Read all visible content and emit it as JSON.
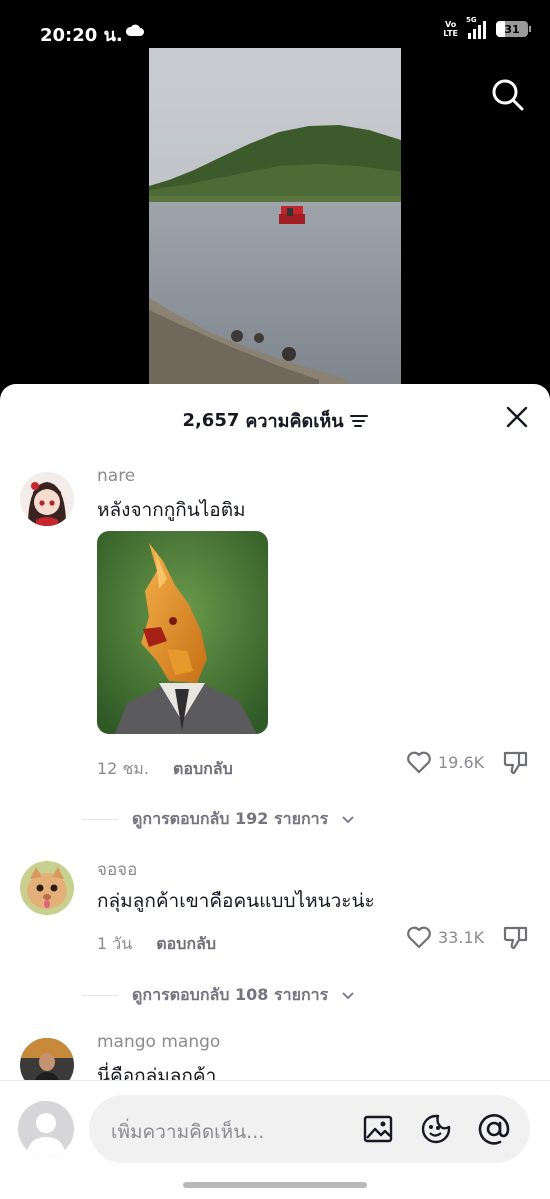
{
  "status": {
    "time": "20:20 น.",
    "volte": [
      "Vo",
      "LTE"
    ],
    "network": "5G",
    "battery": "31"
  },
  "comments_sheet": {
    "count": "2,657",
    "title_label": "ความคิดเห็น",
    "comments": [
      {
        "user": "nare",
        "text": "หลังจากกูกินไอติม",
        "time": "12 ชม.",
        "reply_label": "ตอบกลับ",
        "likes": "19.6K",
        "view_replies": "ดูการตอบกลับ 192 รายการ"
      },
      {
        "user": "จอจอ",
        "text": "กลุ่มลูกค้าเขาคือคนแบบไหนวะน่ะ",
        "time": "1 วัน",
        "reply_label": "ตอบกลับ",
        "likes": "33.1K",
        "view_replies": "ดูการตอบกลับ 108 รายการ"
      },
      {
        "user": "mango mango",
        "text": "นี่คือกลุ่มลูกค้า"
      }
    ]
  },
  "input": {
    "placeholder": "เพิ่มความคิดเห็น..."
  },
  "icons": [
    "cloud-icon",
    "search-icon",
    "sort-icon",
    "close-icon",
    "heart-icon",
    "dislike-icon",
    "chevron-down-icon",
    "image-icon",
    "emoji-icon",
    "mention-icon"
  ]
}
